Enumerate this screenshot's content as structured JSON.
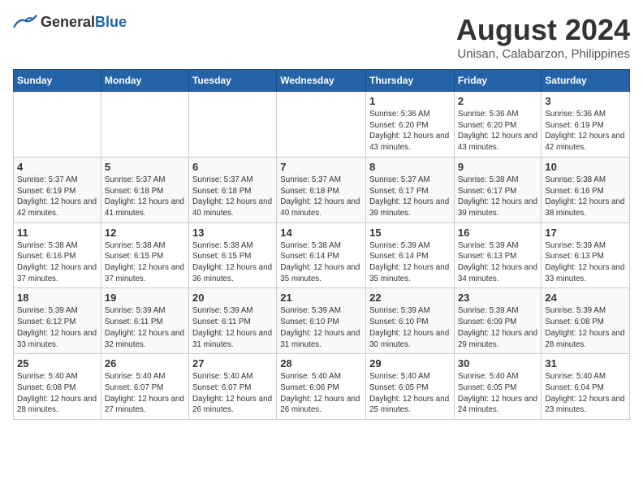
{
  "logo": {
    "general": "General",
    "blue": "Blue"
  },
  "header": {
    "title": "August 2024",
    "subtitle": "Unisan, Calabarzon, Philippines"
  },
  "weekdays": [
    "Sunday",
    "Monday",
    "Tuesday",
    "Wednesday",
    "Thursday",
    "Friday",
    "Saturday"
  ],
  "weeks": [
    [
      {
        "day": "",
        "info": ""
      },
      {
        "day": "",
        "info": ""
      },
      {
        "day": "",
        "info": ""
      },
      {
        "day": "",
        "info": ""
      },
      {
        "day": "1",
        "info": "Sunrise: 5:36 AM\nSunset: 6:20 PM\nDaylight: 12 hours and 43 minutes."
      },
      {
        "day": "2",
        "info": "Sunrise: 5:36 AM\nSunset: 6:20 PM\nDaylight: 12 hours and 43 minutes."
      },
      {
        "day": "3",
        "info": "Sunrise: 5:36 AM\nSunset: 6:19 PM\nDaylight: 12 hours and 42 minutes."
      }
    ],
    [
      {
        "day": "4",
        "info": "Sunrise: 5:37 AM\nSunset: 6:19 PM\nDaylight: 12 hours and 42 minutes."
      },
      {
        "day": "5",
        "info": "Sunrise: 5:37 AM\nSunset: 6:18 PM\nDaylight: 12 hours and 41 minutes."
      },
      {
        "day": "6",
        "info": "Sunrise: 5:37 AM\nSunset: 6:18 PM\nDaylight: 12 hours and 40 minutes."
      },
      {
        "day": "7",
        "info": "Sunrise: 5:37 AM\nSunset: 6:18 PM\nDaylight: 12 hours and 40 minutes."
      },
      {
        "day": "8",
        "info": "Sunrise: 5:37 AM\nSunset: 6:17 PM\nDaylight: 12 hours and 39 minutes."
      },
      {
        "day": "9",
        "info": "Sunrise: 5:38 AM\nSunset: 6:17 PM\nDaylight: 12 hours and 39 minutes."
      },
      {
        "day": "10",
        "info": "Sunrise: 5:38 AM\nSunset: 6:16 PM\nDaylight: 12 hours and 38 minutes."
      }
    ],
    [
      {
        "day": "11",
        "info": "Sunrise: 5:38 AM\nSunset: 6:16 PM\nDaylight: 12 hours and 37 minutes."
      },
      {
        "day": "12",
        "info": "Sunrise: 5:38 AM\nSunset: 6:15 PM\nDaylight: 12 hours and 37 minutes."
      },
      {
        "day": "13",
        "info": "Sunrise: 5:38 AM\nSunset: 6:15 PM\nDaylight: 12 hours and 36 minutes."
      },
      {
        "day": "14",
        "info": "Sunrise: 5:38 AM\nSunset: 6:14 PM\nDaylight: 12 hours and 35 minutes."
      },
      {
        "day": "15",
        "info": "Sunrise: 5:39 AM\nSunset: 6:14 PM\nDaylight: 12 hours and 35 minutes."
      },
      {
        "day": "16",
        "info": "Sunrise: 5:39 AM\nSunset: 6:13 PM\nDaylight: 12 hours and 34 minutes."
      },
      {
        "day": "17",
        "info": "Sunrise: 5:39 AM\nSunset: 6:13 PM\nDaylight: 12 hours and 33 minutes."
      }
    ],
    [
      {
        "day": "18",
        "info": "Sunrise: 5:39 AM\nSunset: 6:12 PM\nDaylight: 12 hours and 33 minutes."
      },
      {
        "day": "19",
        "info": "Sunrise: 5:39 AM\nSunset: 6:11 PM\nDaylight: 12 hours and 32 minutes."
      },
      {
        "day": "20",
        "info": "Sunrise: 5:39 AM\nSunset: 6:11 PM\nDaylight: 12 hours and 31 minutes."
      },
      {
        "day": "21",
        "info": "Sunrise: 5:39 AM\nSunset: 6:10 PM\nDaylight: 12 hours and 31 minutes."
      },
      {
        "day": "22",
        "info": "Sunrise: 5:39 AM\nSunset: 6:10 PM\nDaylight: 12 hours and 30 minutes."
      },
      {
        "day": "23",
        "info": "Sunrise: 5:39 AM\nSunset: 6:09 PM\nDaylight: 12 hours and 29 minutes."
      },
      {
        "day": "24",
        "info": "Sunrise: 5:39 AM\nSunset: 6:08 PM\nDaylight: 12 hours and 28 minutes."
      }
    ],
    [
      {
        "day": "25",
        "info": "Sunrise: 5:40 AM\nSunset: 6:08 PM\nDaylight: 12 hours and 28 minutes."
      },
      {
        "day": "26",
        "info": "Sunrise: 5:40 AM\nSunset: 6:07 PM\nDaylight: 12 hours and 27 minutes."
      },
      {
        "day": "27",
        "info": "Sunrise: 5:40 AM\nSunset: 6:07 PM\nDaylight: 12 hours and 26 minutes."
      },
      {
        "day": "28",
        "info": "Sunrise: 5:40 AM\nSunset: 6:06 PM\nDaylight: 12 hours and 26 minutes."
      },
      {
        "day": "29",
        "info": "Sunrise: 5:40 AM\nSunset: 6:05 PM\nDaylight: 12 hours and 25 minutes."
      },
      {
        "day": "30",
        "info": "Sunrise: 5:40 AM\nSunset: 6:05 PM\nDaylight: 12 hours and 24 minutes."
      },
      {
        "day": "31",
        "info": "Sunrise: 5:40 AM\nSunset: 6:04 PM\nDaylight: 12 hours and 23 minutes."
      }
    ]
  ]
}
